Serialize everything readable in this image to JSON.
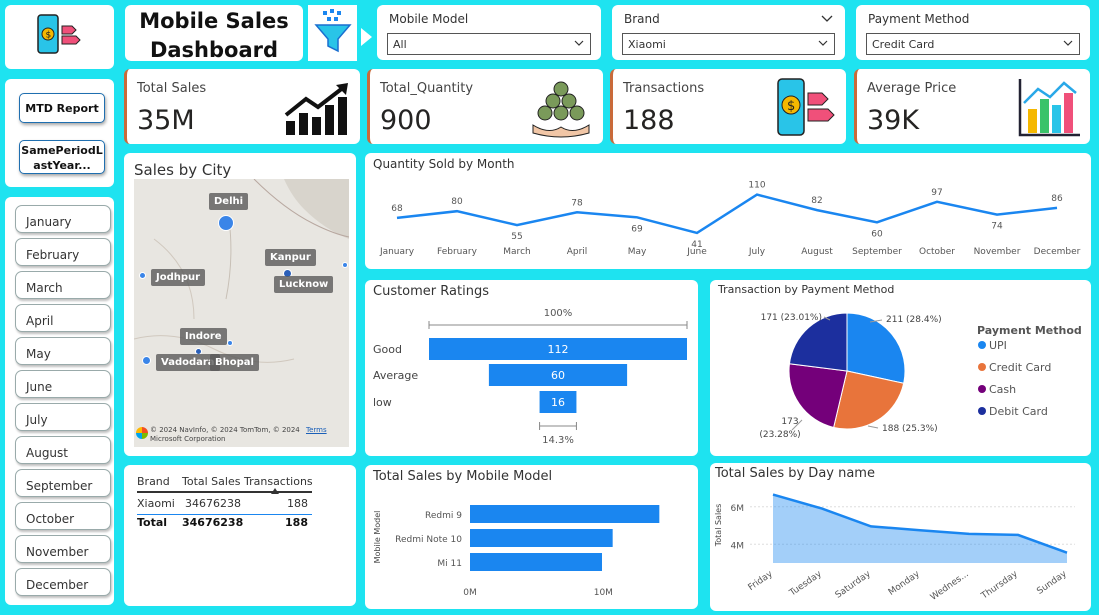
{
  "header": {
    "title": "Mobile Sales Dashboard",
    "title_line1": "Mobile Sales",
    "title_line2": "Dashboard"
  },
  "filters": {
    "mobile_model": {
      "label": "Mobile Model",
      "value": "All"
    },
    "brand": {
      "label": "Brand",
      "value": "Xiaomi"
    },
    "payment_method": {
      "label": "Payment Method",
      "value": "Credit Card"
    }
  },
  "nav_buttons": {
    "mtd": "MTD Report",
    "spl_line1": "SamePeriodL",
    "spl_line2": "astYear..."
  },
  "months": [
    "January",
    "February",
    "March",
    "April",
    "May",
    "June",
    "July",
    "August",
    "September",
    "October",
    "November",
    "December"
  ],
  "kpis": {
    "total_sales": {
      "label": "Total Sales",
      "value": "35M"
    },
    "total_quantity": {
      "label": "Total_Quantity",
      "value": "900"
    },
    "transactions": {
      "label": "Transactions",
      "value": "188"
    },
    "average_price": {
      "label": "Average Price",
      "value": "39K"
    }
  },
  "map": {
    "title": "Sales by City",
    "cities": [
      "Delhi",
      "Kanpur",
      "Jodhpur",
      "Lucknow",
      "Indore",
      "Vadodara",
      "Bhopal"
    ],
    "attribution": "© 2024 NavInfo, © 2024 TomTom, © 2024 Microsoft Corporation",
    "terms": "Terms"
  },
  "table": {
    "headers": [
      "Brand",
      "Total Sales",
      "Transactions"
    ],
    "rows": [
      [
        "Xiaomi",
        "34676238",
        "188"
      ]
    ],
    "total": [
      "Total",
      "34676238",
      "188"
    ]
  },
  "chart_data": [
    {
      "type": "line",
      "title": "Quantity Sold by Month",
      "categories": [
        "January",
        "February",
        "March",
        "April",
        "May",
        "June",
        "July",
        "August",
        "September",
        "October",
        "November",
        "December"
      ],
      "values": [
        68,
        80,
        55,
        78,
        69,
        41,
        110,
        82,
        60,
        97,
        74,
        86
      ],
      "color": "#1a86f0"
    },
    {
      "type": "bar",
      "title": "Customer Ratings",
      "categories": [
        "Good",
        "Average",
        "low"
      ],
      "values": [
        112,
        60,
        16
      ],
      "top_label": "100%",
      "bottom_label": "14.3%",
      "color": "#1a86f0"
    },
    {
      "type": "pie",
      "title": "Transaction by Payment Method",
      "legend_title": "Payment Method",
      "slices": [
        {
          "name": "UPI",
          "value": 211,
          "label": "211 (28.4%)",
          "color": "#1a86f0"
        },
        {
          "name": "Credit Card",
          "value": 188,
          "label": "188 (25.3%)",
          "color": "#e8743b"
        },
        {
          "name": "Cash",
          "value": 173,
          "label": "173 (23.28%)",
          "label_line1": "173",
          "label_line2": "(23.28%)",
          "color": "#74007a"
        },
        {
          "name": "Debit Card",
          "value": 171,
          "label": "171 (23.01%)",
          "color": "#1c2f9e"
        }
      ]
    },
    {
      "type": "bar",
      "title": "Total Sales by Mobile Model",
      "orientation": "horizontal",
      "ylabel": "Mobile Model",
      "categories": [
        "Redmi 9",
        "Redmi Note 10",
        "Mi 11"
      ],
      "values": [
        14200000,
        10700000,
        9900000
      ],
      "xticks": [
        "0M",
        "10M"
      ],
      "xlim": [
        0,
        15000000
      ],
      "color": "#1a86f0"
    },
    {
      "type": "area",
      "title": "Total Sales by Day name",
      "ylabel": "Total Sales",
      "categories": [
        "Friday",
        "Tuesday",
        "Saturday",
        "Monday",
        "Wednes...",
        "Thursday",
        "Sunday"
      ],
      "values": [
        6650000,
        5900000,
        4950000,
        4750000,
        4550000,
        4500000,
        3550000
      ],
      "yticks": [
        "6M",
        "4M"
      ],
      "ylim": [
        3000000,
        7000000
      ],
      "color": "#1a86f0"
    }
  ]
}
